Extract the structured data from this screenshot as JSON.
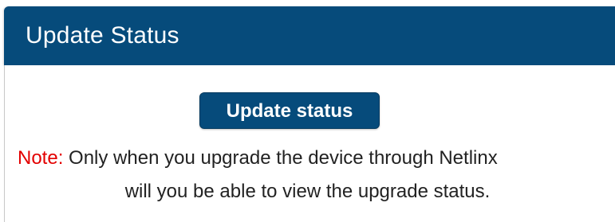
{
  "panel": {
    "title": "Update Status"
  },
  "button": {
    "label": "Update status"
  },
  "note": {
    "label": "Note:",
    "line1": " Only when you upgrade the device through Netlinx",
    "line2": "will you be able to view the upgrade status."
  },
  "colors": {
    "header_bg": "#064b7b",
    "button_bg": "#064b7b",
    "note_label": "#e30000",
    "text": "#222222"
  }
}
